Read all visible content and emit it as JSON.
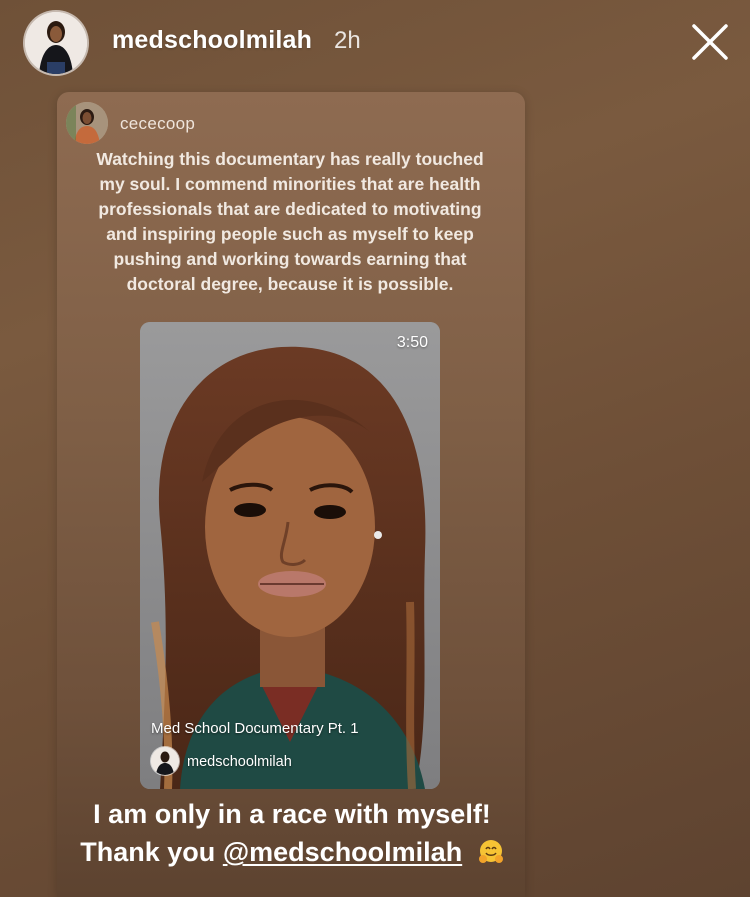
{
  "header": {
    "username": "medschoolmilah",
    "time": "2h"
  },
  "shared_post": {
    "username": "cececoop",
    "caption": "Watching this documentary has really touched my soul.  I commend minorities that are health professionals that are dedicated to motivating and inspiring people such as myself to keep pushing and working towards earning that doctoral degree, because it is possible.",
    "video": {
      "duration": "3:50",
      "title": "Med School Documentary Pt. 1",
      "author": "medschoolmilah"
    }
  },
  "overlay_text": {
    "line1": "I am only in a race with myself!",
    "thank_you": "Thank you",
    "mention": "@medschoolmilah",
    "emoji": "hugging-face-emoji"
  },
  "icons": {
    "close": "close-icon"
  }
}
